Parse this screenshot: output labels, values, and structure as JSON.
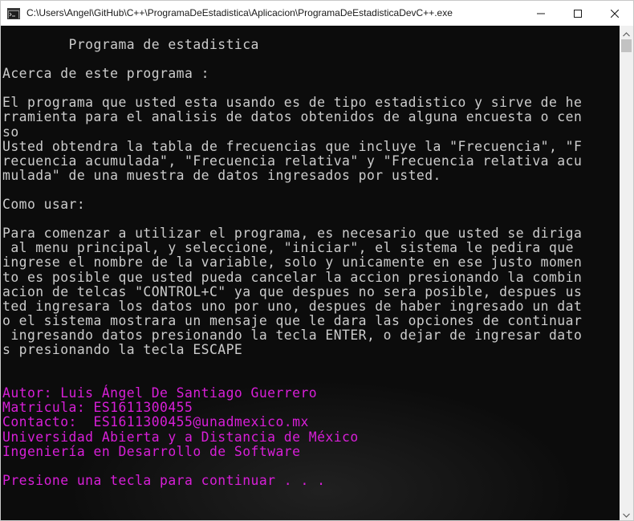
{
  "window": {
    "title": "C:\\Users\\Angel\\GitHub\\C++\\ProgramaDeEstadistica\\Aplicacion\\ProgramaDeEstadisticaDevC++.exe"
  },
  "controls": {
    "minimize_icon": "minimize-icon",
    "maximize_icon": "maximize-icon",
    "close_icon": "close-icon"
  },
  "colors": {
    "console_background": "#0c0c0c",
    "console_text": "#cccccc",
    "magenta_text": "#d81fd8"
  },
  "console": {
    "lines": [
      {
        "text": "        Programa de estadistica",
        "color": "default"
      },
      {
        "text": "",
        "color": "default"
      },
      {
        "text": "Acerca de este programa :",
        "color": "default"
      },
      {
        "text": "",
        "color": "default"
      },
      {
        "text": "El programa que usted esta usando es de tipo estadistico y sirve de he",
        "color": "default"
      },
      {
        "text": "rramienta para el analisis de datos obtenidos de alguna encuesta o cen",
        "color": "default"
      },
      {
        "text": "so",
        "color": "default"
      },
      {
        "text": "Usted obtendra la tabla de frecuencias que incluye la \"Frecuencia\", \"F",
        "color": "default"
      },
      {
        "text": "recuencia acumulada\", \"Frecuencia relativa\" y \"Frecuencia relativa acu",
        "color": "default"
      },
      {
        "text": "mulada\" de una muestra de datos ingresados por usted.",
        "color": "default"
      },
      {
        "text": "",
        "color": "default"
      },
      {
        "text": "Como usar:",
        "color": "default"
      },
      {
        "text": "",
        "color": "default"
      },
      {
        "text": "Para comenzar a utilizar el programa, es necesario que usted se diriga",
        "color": "default"
      },
      {
        "text": " al menu principal, y seleccione, \"iniciar\", el sistema le pedira que",
        "color": "default"
      },
      {
        "text": "ingrese el nombre de la variable, solo y unicamente en ese justo momen",
        "color": "default"
      },
      {
        "text": "to es posible que usted pueda cancelar la accion presionando la combin",
        "color": "default"
      },
      {
        "text": "acion de telcas \"CONTROL+C\" ya que despues no sera posible, despues us",
        "color": "default"
      },
      {
        "text": "ted ingresara los datos uno por uno, despues de haber ingresado un dat",
        "color": "default"
      },
      {
        "text": "o el sistema mostrara un mensaje que le dara las opciones de continuar",
        "color": "default"
      },
      {
        "text": " ingresando datos presionando la tecla ENTER, o dejar de ingresar dato",
        "color": "default"
      },
      {
        "text": "s presionando la tecla ESCAPE",
        "color": "default"
      },
      {
        "text": "",
        "color": "default"
      },
      {
        "text": "",
        "color": "default"
      },
      {
        "text": "Autor: Luis Ángel De Santiago Guerrero",
        "color": "magenta"
      },
      {
        "text": "Matricula: ES1611300455",
        "color": "magenta"
      },
      {
        "text": "Contacto:  ES1611300455@unadmexico.mx",
        "color": "magenta"
      },
      {
        "text": "Universidad Abierta y a Distancia de México",
        "color": "magenta"
      },
      {
        "text": "Ingeniería en Desarrollo de Software",
        "color": "magenta"
      },
      {
        "text": "",
        "color": "magenta"
      },
      {
        "text": "Presione una tecla para continuar . . .",
        "color": "magenta"
      }
    ]
  }
}
